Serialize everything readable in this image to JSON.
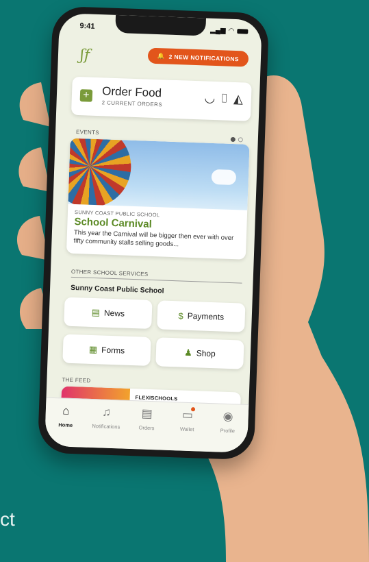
{
  "corner_text": "ct",
  "status_bar": {
    "time": "9:41"
  },
  "notifications_button": "2 NEW NOTIFICATIONS",
  "order_food": {
    "title": "Order Food",
    "subtitle": "2 CURRENT ORDERS"
  },
  "events": {
    "label": "EVENTS",
    "card": {
      "school": "SUNNY COAST PUBLIC SCHOOL",
      "title": "School Carnival",
      "description": "This year the Carnival will be bigger then ever with over fifty community stalls selling goods..."
    }
  },
  "other_services": {
    "label": "OTHER SCHOOL SERVICES",
    "school_name": "Sunny Coast Public School",
    "buttons": {
      "news": "News",
      "payments": "Payments",
      "forms": "Forms",
      "shop": "Shop"
    }
  },
  "feed": {
    "label": "THE FEED",
    "source": "FLEXISCHOOLS"
  },
  "tabs": {
    "home": "Home",
    "notifications": "Notifications",
    "orders": "Orders",
    "wallet": "Wallet",
    "profile": "Profile"
  },
  "colors": {
    "background": "#0a7671",
    "accent_green": "#7a9b3a",
    "notification_orange": "#e2551b"
  }
}
